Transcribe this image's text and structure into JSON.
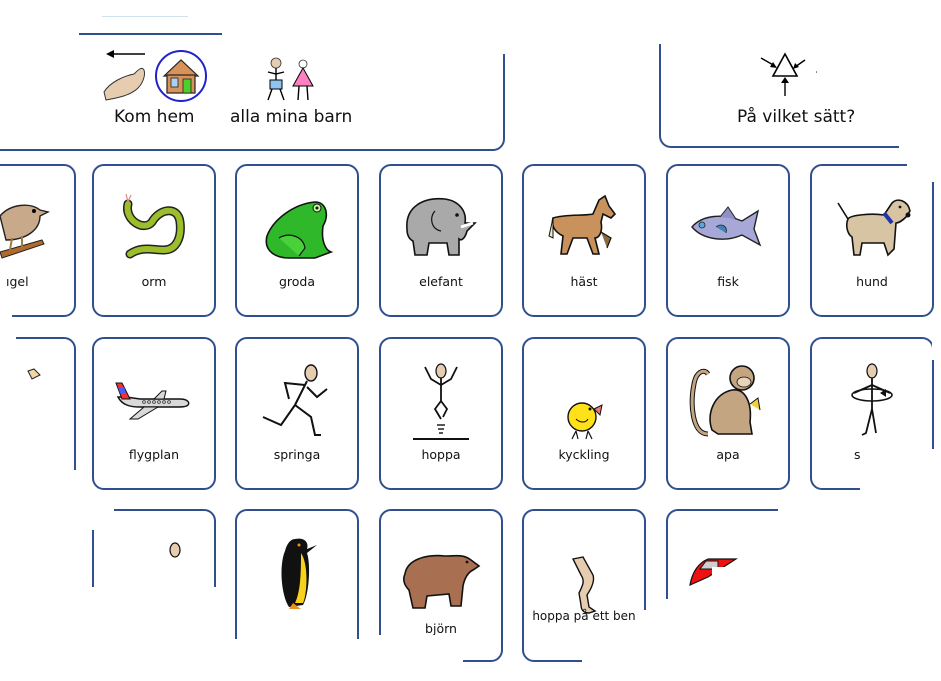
{
  "sentence_bar": {
    "words": [
      {
        "label": "Kom hem",
        "icon": "come-home-icon"
      },
      {
        "label": "alla mina barn",
        "icon": "children-icon"
      }
    ]
  },
  "question_panel": {
    "label": "På vilket sätt?",
    "icon": "how-triangle-arrows-icon"
  },
  "grid": {
    "rows": [
      [
        {
          "label": "fågel",
          "visible_label": "ıgel",
          "icon": "bird-icon"
        },
        {
          "label": "orm",
          "icon": "snake-icon"
        },
        {
          "label": "groda",
          "icon": "frog-icon"
        },
        {
          "label": "elefant",
          "icon": "elephant-icon"
        },
        {
          "label": "häst",
          "icon": "horse-icon"
        },
        {
          "label": "fisk",
          "icon": "fish-icon"
        },
        {
          "label": "hund",
          "icon": "dog-icon"
        }
      ],
      [
        {
          "label": "",
          "icon": "partial-animal-icon"
        },
        {
          "label": "flygplan",
          "icon": "airplane-icon"
        },
        {
          "label": "springa",
          "icon": "run-icon"
        },
        {
          "label": "hoppa",
          "icon": "jump-icon"
        },
        {
          "label": "kyckling",
          "icon": "chick-icon"
        },
        {
          "label": "apa",
          "icon": "monkey-icon"
        },
        {
          "label": "s",
          "icon": "spin-person-icon"
        }
      ],
      [
        {
          "label": "",
          "icon": "partial-head-icon"
        },
        {
          "label": "",
          "icon": "penguin-icon"
        },
        {
          "label": "björn",
          "icon": "bear-icon"
        },
        {
          "label": "hoppa på ett ben",
          "icon": "leg-icon"
        },
        {
          "label": "",
          "icon": "car-icon"
        }
      ]
    ]
  },
  "colors": {
    "card_border": "#2f4f8f",
    "background": "#ffffff"
  }
}
